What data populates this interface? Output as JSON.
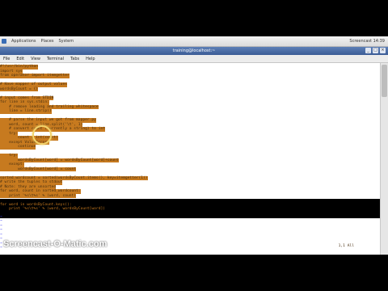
{
  "top_panel": {
    "menus": [
      "Applications",
      "Places",
      "System"
    ],
    "clock": "Screencast 14:39"
  },
  "window": {
    "title": "training@localhost:~",
    "menu": [
      "File",
      "Edit",
      "View",
      "Terminal",
      "Tabs",
      "Help"
    ]
  },
  "terminal": {
    "lines": [
      "#!/usr/bin/python",
      "import sys",
      "from operator import itemgetter",
      "",
      "# Have mapper of output values",
      "wordsByCount = {}",
      "",
      "# input comes from STDIN",
      "for line in sys.stdin:",
      "    # remove leading and trailing whitespace",
      "    line = line.strip()",
      "",
      "    # parse the input we got from mapper.py",
      "    word, count = line.split('\\t', 1)",
      "    # convert count (currently a string) to int",
      "    try:",
      "        count = int(count)",
      "    except ValueError:",
      "        continue",
      "",
      "    try:",
      "        wordsByCount[word] = wordsByCount[word]+count",
      "    except:",
      "        wordsByCount[word] = count",
      "",
      "sorted_wordcount = sorted(wordsByCount.items(), key=itemgetter(1))",
      "# write the tuples to stdout",
      "# Note: they are unsorted",
      "for word, count in sorted_wordcount:",
      "    print '%s\\t%s' % (word, count)",
      "",
      "for word in wordsByCount.keys():",
      "    print '%s\\t%s' % (word, wordsByCount[word])"
    ],
    "tilde": "~",
    "position": "1,1           All"
  },
  "watermark": "Screencast-O-Matic.com"
}
